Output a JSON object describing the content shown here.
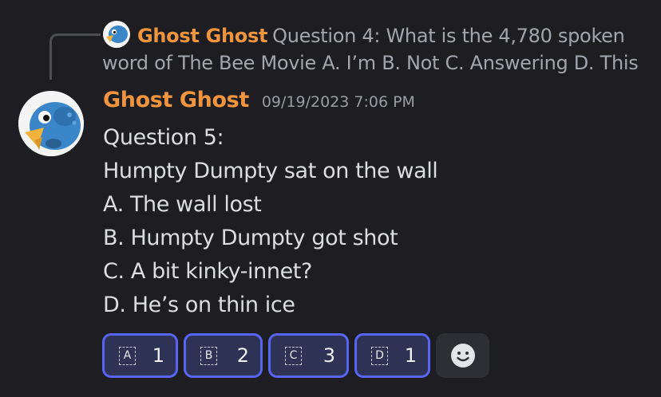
{
  "reply": {
    "author": "Ghost Ghost",
    "text": "Question 4: What is the 4,780 spoken word of The Bee Movie A. I’m B. Not C. Answering D. This"
  },
  "message": {
    "author": "Ghost Ghost",
    "timestamp": "09/19/2023 7:06 PM",
    "lines": [
      "Question 5:",
      "Humpty Dumpty sat on the wall",
      "A. The wall lost",
      "B. Humpty Dumpty got shot",
      "C. A bit kinky-innet?",
      "D. He’s on thin ice"
    ]
  },
  "buttons": [
    {
      "letter": "A",
      "count": "1"
    },
    {
      "letter": "B",
      "count": "2"
    },
    {
      "letter": "C",
      "count": "3"
    },
    {
      "letter": "D",
      "count": "1"
    }
  ],
  "icons": {
    "avatar": "blue-bird-avatar",
    "reaction": "smiley-face-icon"
  },
  "colors": {
    "background": "#1e1e22",
    "author": "#f0943e",
    "button_border": "#5865f2",
    "button_fill": "#2e3254"
  }
}
